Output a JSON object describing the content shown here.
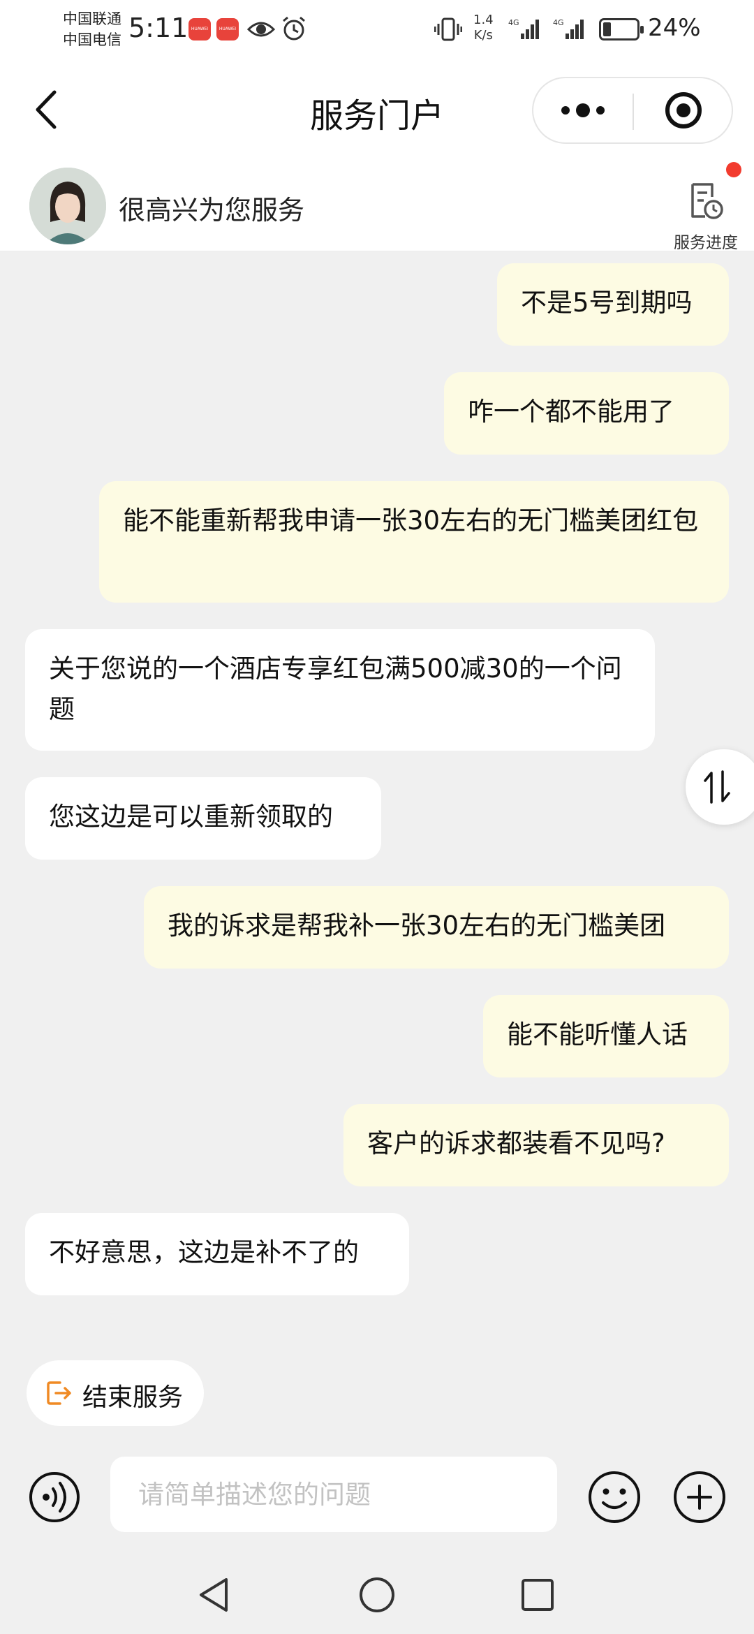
{
  "status_bar": {
    "carrier_1": "中国联通",
    "carrier_2": "中国电信",
    "time": "5:11",
    "app_badge_1": "HUAWEI",
    "app_badge_2": "HUAWEI",
    "net_speed_value": "1.4",
    "net_speed_unit": "K/s",
    "signal_1_label": "4G",
    "signal_2_label": "4G",
    "battery_percent": "24%",
    "battery_level": 0.24,
    "icons": [
      "eye-icon",
      "alarm-icon",
      "vibrate-icon",
      "signal-icon",
      "battery-icon"
    ]
  },
  "nav": {
    "title": "服务门户",
    "back_icon": "chevron-left-icon",
    "more_icon": "more-dots-icon",
    "close_icon": "target-close-icon"
  },
  "agent": {
    "greeting": "很高兴为您服务",
    "progress_label": "服务进度",
    "progress_icon": "document-clock-icon"
  },
  "messages": [
    {
      "role": "user",
      "text": "不是5号到期吗"
    },
    {
      "role": "user",
      "text": "咋一个都不能用了"
    },
    {
      "role": "user",
      "text": "能不能重新帮我申请一张30左右的无门槛美团红包"
    },
    {
      "role": "agent",
      "text": "关于您说的一个酒店专享红包满500减30的一个问题"
    },
    {
      "role": "agent",
      "text": "您这边是可以重新领取的"
    },
    {
      "role": "user",
      "text": "我的诉求是帮我补一张30左右的无门槛美团"
    },
    {
      "role": "user",
      "text": "能不能听懂人话"
    },
    {
      "role": "user",
      "text": "客户的诉求都装看不见吗?"
    },
    {
      "role": "agent",
      "text": "不好意思，这边是补不了的"
    }
  ],
  "end_service": {
    "label": "结束服务",
    "icon": "exit-icon"
  },
  "input": {
    "placeholder": "请简单描述您的问题",
    "value": "",
    "voice_icon": "voice-icon",
    "emoji_icon": "emoji-icon",
    "plus_icon": "plus-icon"
  },
  "side_toggle_icon": "swap-vertical-icon",
  "colors": {
    "user_bubble": "#fdfbe3",
    "agent_bubble": "#ffffff",
    "background": "#f0f0f0",
    "accent_orange": "#f08a24",
    "badge_red": "#f23b2e"
  }
}
